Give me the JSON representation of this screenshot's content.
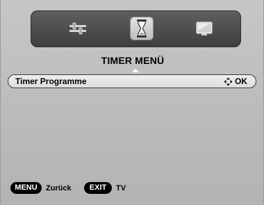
{
  "tabs": [
    {
      "name": "settings",
      "icon": "sliders-icon",
      "selected": false
    },
    {
      "name": "timer",
      "icon": "hourglass-icon",
      "selected": true
    },
    {
      "name": "picture",
      "icon": "tv-screen-icon",
      "selected": false
    }
  ],
  "menu": {
    "title": "TIMER MENÜ",
    "items": [
      {
        "label": "Timer Programme",
        "action": "OK",
        "action_icon": "navigation-arrows-icon"
      }
    ]
  },
  "footer": {
    "menu_key": "MENU",
    "menu_action": "Zurück",
    "exit_key": "EXIT",
    "exit_action": "TV"
  },
  "colors": {
    "background": "#bdbdbd",
    "panel": "#4a4a4a",
    "selected_tab": "#d3d3d3",
    "badge": "#000000"
  }
}
